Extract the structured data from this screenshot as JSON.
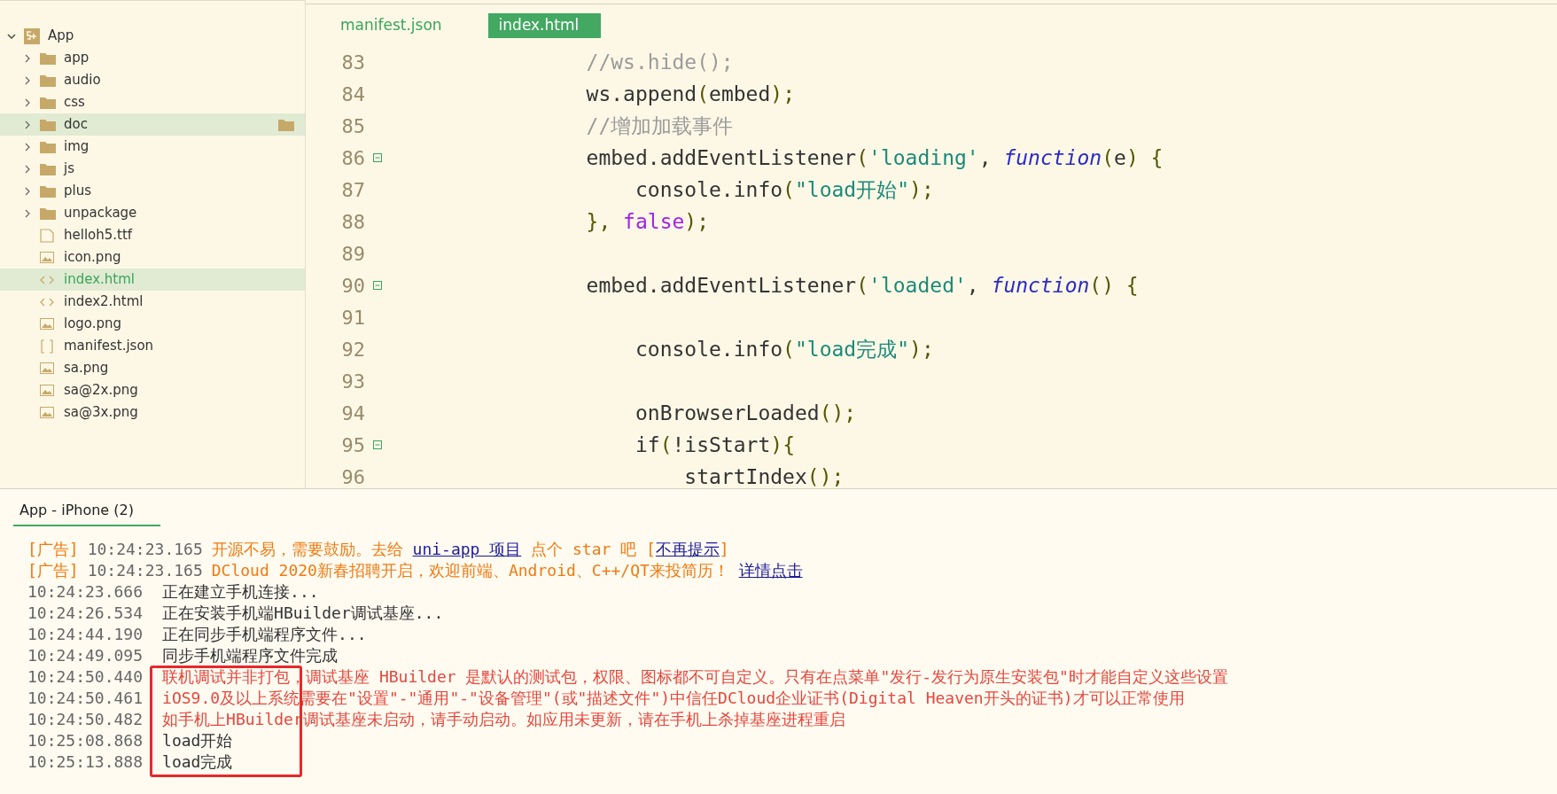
{
  "explorer": {
    "tree": [
      {
        "label": "App",
        "kind": "project",
        "expanded": true,
        "selected": false,
        "hovered": false,
        "children": [
          {
            "label": "app",
            "kind": "folder",
            "expanded": false,
            "selected": false,
            "hovered": false
          },
          {
            "label": "audio",
            "kind": "folder",
            "expanded": false,
            "selected": false,
            "hovered": false
          },
          {
            "label": "css",
            "kind": "folder",
            "expanded": false,
            "selected": false,
            "hovered": false
          },
          {
            "label": "doc",
            "kind": "folder",
            "expanded": false,
            "selected": false,
            "hovered": true
          },
          {
            "label": "img",
            "kind": "folder",
            "expanded": false,
            "selected": false,
            "hovered": false
          },
          {
            "label": "js",
            "kind": "folder",
            "expanded": false,
            "selected": false,
            "hovered": false
          },
          {
            "label": "plus",
            "kind": "folder",
            "expanded": false,
            "selected": false,
            "hovered": false
          },
          {
            "label": "unpackage",
            "kind": "folder",
            "expanded": false,
            "selected": false,
            "hovered": false
          },
          {
            "label": "helloh5.ttf",
            "kind": "file",
            "selected": false,
            "hovered": false
          },
          {
            "label": "icon.png",
            "kind": "image",
            "selected": false,
            "hovered": false
          },
          {
            "label": "index.html",
            "kind": "html",
            "selected": true,
            "hovered": false
          },
          {
            "label": "index2.html",
            "kind": "html",
            "selected": false,
            "hovered": false
          },
          {
            "label": "logo.png",
            "kind": "image",
            "selected": false,
            "hovered": false
          },
          {
            "label": "manifest.json",
            "kind": "json",
            "selected": false,
            "hovered": false
          },
          {
            "label": "sa.png",
            "kind": "image",
            "selected": false,
            "hovered": false
          },
          {
            "label": "sa@2x.png",
            "kind": "image",
            "selected": false,
            "hovered": false
          },
          {
            "label": "sa@3x.png",
            "kind": "image",
            "selected": false,
            "hovered": false
          }
        ]
      }
    ]
  },
  "editor": {
    "tabs": [
      {
        "label": "manifest.json",
        "selected": false
      },
      {
        "label": "index.html",
        "selected": true
      }
    ],
    "lines": [
      {
        "number": "83",
        "foldable": false,
        "tokens": [
          {
            "text": "                //ws.hide();",
            "kind": "comment"
          }
        ]
      },
      {
        "number": "84",
        "foldable": false,
        "tokens": [
          {
            "text": "                ws.append",
            "kind": "plain"
          },
          {
            "text": "(",
            "kind": "punct"
          },
          {
            "text": "embed",
            "kind": "plain"
          },
          {
            "text": ");",
            "kind": "punct"
          }
        ]
      },
      {
        "number": "85",
        "foldable": false,
        "tokens": [
          {
            "text": "                //增加加载事件",
            "kind": "comment"
          }
        ]
      },
      {
        "number": "86",
        "foldable": true,
        "tokens": [
          {
            "text": "                embed.addEventListener",
            "kind": "plain"
          },
          {
            "text": "(",
            "kind": "punct"
          },
          {
            "text": "'loading'",
            "kind": "string"
          },
          {
            "text": ", ",
            "kind": "plain"
          },
          {
            "text": "function",
            "kind": "keyword"
          },
          {
            "text": "(",
            "kind": "punct"
          },
          {
            "text": "e",
            "kind": "plain"
          },
          {
            "text": ") {",
            "kind": "punct"
          }
        ]
      },
      {
        "number": "87",
        "foldable": false,
        "tokens": [
          {
            "text": "                    console.info",
            "kind": "plain"
          },
          {
            "text": "(",
            "kind": "punct"
          },
          {
            "text": "\"load开始\"",
            "kind": "string"
          },
          {
            "text": ");",
            "kind": "punct"
          }
        ]
      },
      {
        "number": "88",
        "foldable": false,
        "tokens": [
          {
            "text": "                }, ",
            "kind": "punct"
          },
          {
            "text": "false",
            "kind": "literal"
          },
          {
            "text": ");",
            "kind": "punct"
          }
        ]
      },
      {
        "number": "89",
        "foldable": false
      },
      {
        "number": "90",
        "foldable": true,
        "tokens": [
          {
            "text": "                embed.addEventListener",
            "kind": "plain"
          },
          {
            "text": "(",
            "kind": "punct"
          },
          {
            "text": "'loaded'",
            "kind": "string"
          },
          {
            "text": ", ",
            "kind": "plain"
          },
          {
            "text": "function",
            "kind": "keyword"
          },
          {
            "text": "() {",
            "kind": "punct"
          }
        ]
      },
      {
        "number": "91",
        "foldable": false
      },
      {
        "number": "92",
        "foldable": false,
        "tokens": [
          {
            "text": "                    console.info",
            "kind": "plain"
          },
          {
            "text": "(",
            "kind": "punct"
          },
          {
            "text": "\"load完成\"",
            "kind": "string"
          },
          {
            "text": ");",
            "kind": "punct"
          }
        ]
      },
      {
        "number": "93",
        "foldable": false
      },
      {
        "number": "94",
        "foldable": false,
        "tokens": [
          {
            "text": "                    onBrowserLoaded",
            "kind": "plain"
          },
          {
            "text": "();",
            "kind": "punct"
          }
        ]
      },
      {
        "number": "95",
        "foldable": true,
        "tokens": [
          {
            "text": "                    if",
            "kind": "plain"
          },
          {
            "text": "(",
            "kind": "punct"
          },
          {
            "text": "!isStart",
            "kind": "plain"
          },
          {
            "text": "){",
            "kind": "punct"
          }
        ]
      },
      {
        "number": "96",
        "foldable": false,
        "tokens": [
          {
            "text": "                        startIndex",
            "kind": "plain"
          },
          {
            "text": "();",
            "kind": "punct"
          }
        ]
      }
    ]
  },
  "console": {
    "title": "App - iPhone (2)",
    "lines": [
      {
        "tag": "[广告]",
        "time": "10:24:23.165",
        "segments": [
          {
            "text": "开源不易，需要鼓励。去给 ",
            "kind": "ad"
          },
          {
            "text": "uni-app 项目",
            "kind": "link"
          },
          {
            "text": " 点个 star 吧 [",
            "kind": "ad"
          },
          {
            "text": "不再提示",
            "kind": "link"
          },
          {
            "text": "]",
            "kind": "ad"
          }
        ]
      },
      {
        "tag": "[广告]",
        "time": "10:24:23.165",
        "segments": [
          {
            "text": "DCloud 2020新春招聘开启，欢迎前端、Android、C++/QT来投简历！ ",
            "kind": "ad"
          },
          {
            "text": "详情点击",
            "kind": "link"
          }
        ]
      },
      {
        "time": "10:24:23.666",
        "segments": [
          {
            "text": "正在建立手机连接...",
            "kind": "normal"
          }
        ]
      },
      {
        "time": "10:24:26.534",
        "segments": [
          {
            "text": "正在安装手机端HBuilder调试基座...",
            "kind": "normal"
          }
        ]
      },
      {
        "time": "10:24:44.190",
        "segments": [
          {
            "text": "正在同步手机端程序文件...",
            "kind": "normal"
          }
        ]
      },
      {
        "time": "10:24:49.095",
        "segments": [
          {
            "text": "同步手机端程序文件完成",
            "kind": "normal"
          }
        ]
      },
      {
        "time": "10:24:50.440",
        "segments": [
          {
            "text": "联机调试并非打包，调试基座 HBuilder 是默认的测试包，权限、图标都不可自定义。只有在点菜单\"发行-发行为原生安装包\"时才能自定义这些设置",
            "kind": "error"
          }
        ]
      },
      {
        "time": "10:24:50.461",
        "segments": [
          {
            "text": "iOS9.0及以上系统需要在\"设置\"-\"通用\"-\"设备管理\"(或\"描述文件\")中信任DCloud企业证书(Digital Heaven开头的证书)才可以正常使用",
            "kind": "error"
          }
        ]
      },
      {
        "time": "10:24:50.482",
        "segments": [
          {
            "text": "如手机上HBuilder调试基座未启动，请手动启动。如应用未更新，请在手机上杀掉基座进程重启",
            "kind": "error"
          }
        ]
      },
      {
        "time": "10:25:08.868",
        "segments": [
          {
            "text": "load开始",
            "kind": "normal"
          }
        ]
      },
      {
        "time": "10:25:13.888",
        "segments": [
          {
            "text": "load完成",
            "kind": "normal"
          }
        ]
      }
    ]
  }
}
